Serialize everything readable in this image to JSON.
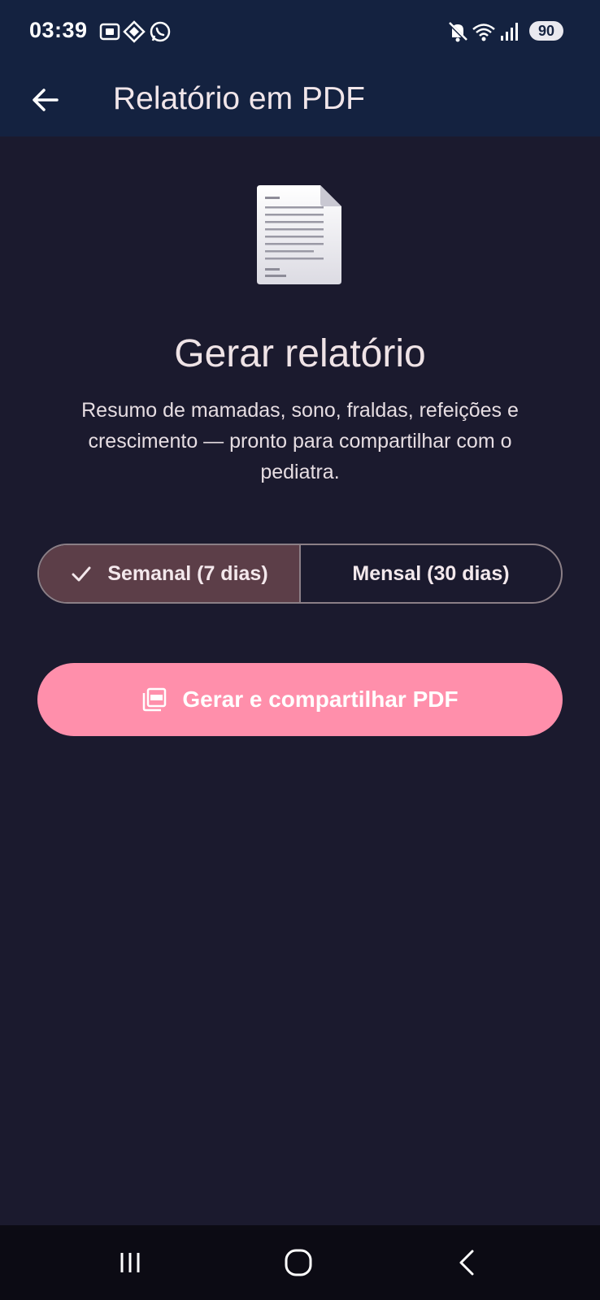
{
  "status_bar": {
    "time": "03:39",
    "battery": "90",
    "icons": [
      "screenshot-icon",
      "location-icon",
      "whatsapp-icon",
      "mute-icon",
      "wifi-icon",
      "signal-icon"
    ]
  },
  "app_bar": {
    "title": "Relatório em PDF",
    "back_icon": "arrow-left-icon"
  },
  "main": {
    "icon": "document-icon",
    "heading": "Gerar relatório",
    "description": "Resumo de mamadas, sono, fraldas, refeições e crescimento — pronto para compartilhar com o pediatra.",
    "period_options": [
      {
        "label": "Semanal (7 dias)",
        "selected": true
      },
      {
        "label": "Mensal (30 dias)",
        "selected": false
      }
    ],
    "generate_button": {
      "label": "Gerar e compartilhar PDF",
      "icon": "pdf-icon"
    }
  },
  "nav_bar": {
    "icons": [
      "recent-apps-icon",
      "home-icon",
      "back-icon"
    ]
  },
  "colors": {
    "status_background": "#142240",
    "page_background": "#1b1a2e",
    "selected_segment": "#5c3e48",
    "primary_button": "#ff8fab",
    "nav_background": "#0c0b14"
  }
}
